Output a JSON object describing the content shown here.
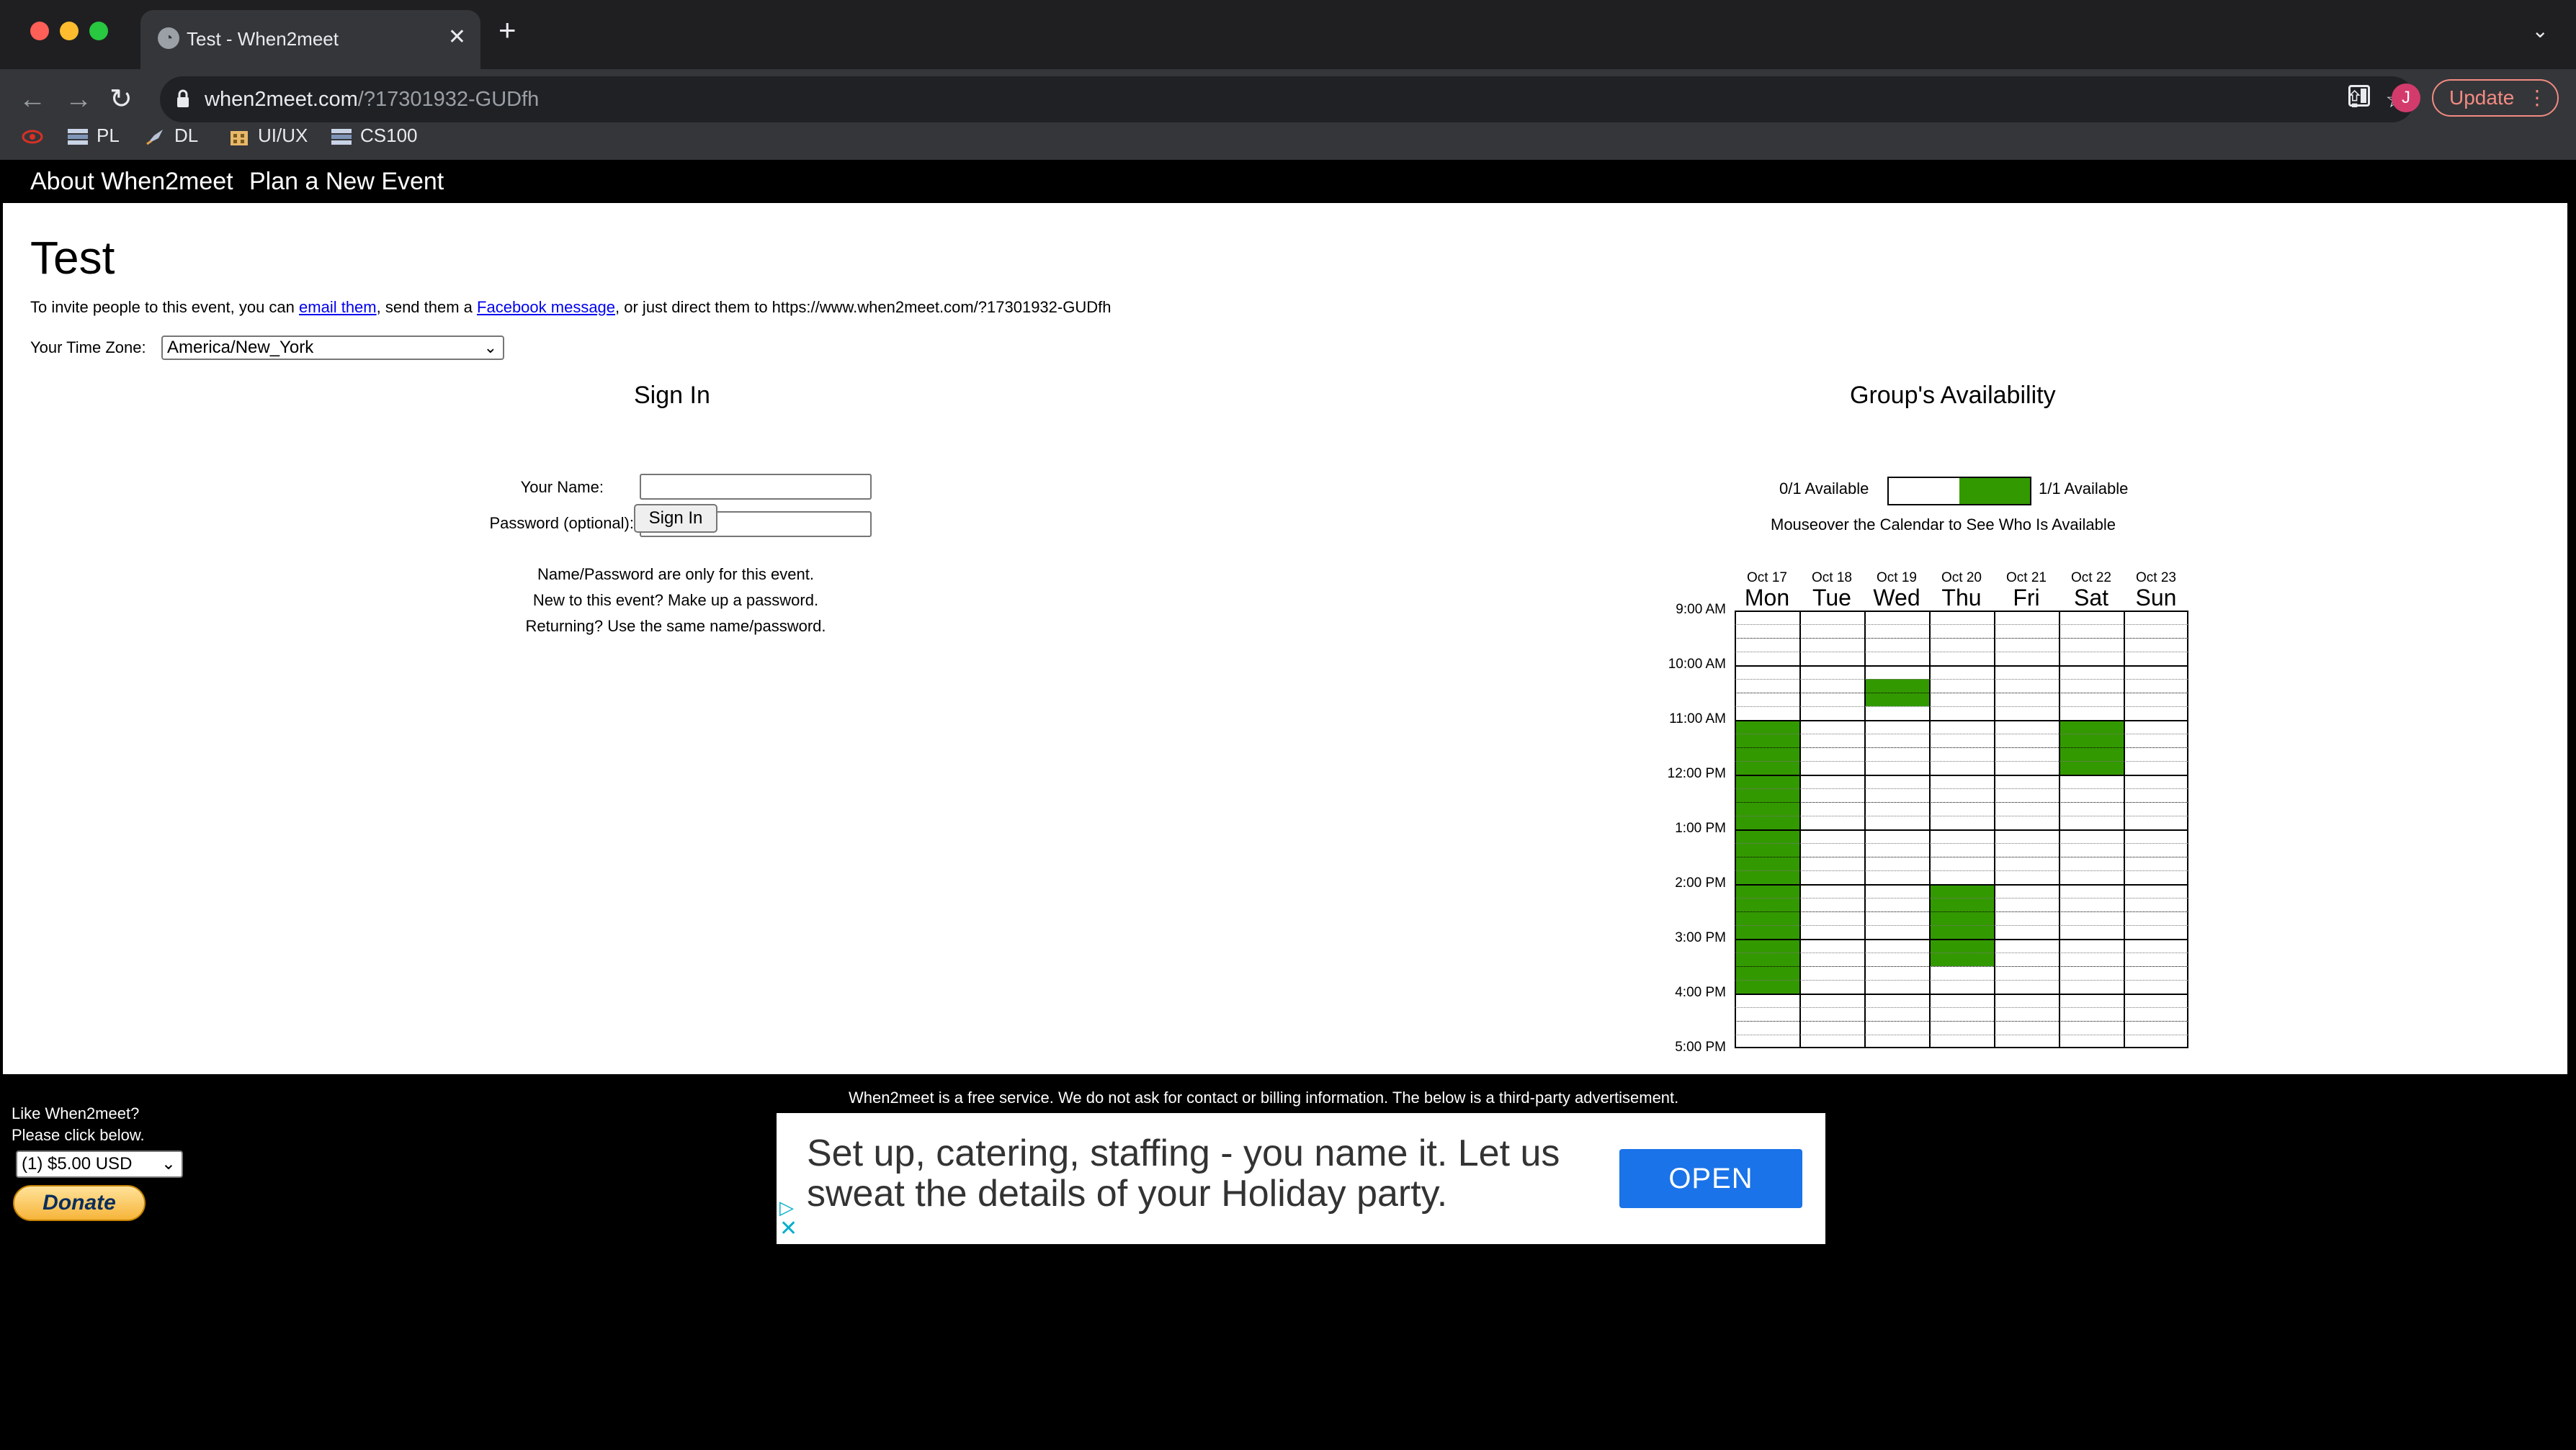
{
  "browser": {
    "tab_title": "Test - When2meet",
    "url_host": "when2meet.com",
    "url_path": "/?17301932-GUDfh",
    "avatar_letter": "J",
    "update_label": "Update",
    "bookmarks": [
      {
        "label": ""
      },
      {
        "label": "PL"
      },
      {
        "label": "DL"
      },
      {
        "label": "UI/UX"
      },
      {
        "label": "CS100"
      }
    ]
  },
  "nav": {
    "about": "About When2meet",
    "plan": "Plan a New Event"
  },
  "event": {
    "title": "Test",
    "invite_prefix": "To invite people to this event, you can ",
    "invite_email": "email them",
    "invite_mid": ", send them a ",
    "invite_fb": "Facebook message",
    "invite_suffix": ", or just direct them to https://www.when2meet.com/?17301932-GUDfh",
    "timezone_label": "Your Time Zone:",
    "timezone_value": "America/New_York"
  },
  "signin": {
    "heading": "Sign In",
    "name_label": "Your Name:",
    "password_label": "Password (optional):",
    "button": "Sign In",
    "note1": "Name/Password are only for this event.",
    "note2": "New to this event? Make up a password.",
    "note3": "Returning? Use the same name/password."
  },
  "availability": {
    "heading": "Group's Availability",
    "legend_min": "0/1 Available",
    "legend_max": "1/1 Available",
    "mouseover": "Mouseover the Calendar to See Who Is Available",
    "available_color": "#339900",
    "days": [
      {
        "date": "Oct 17",
        "name": "Mon"
      },
      {
        "date": "Oct 18",
        "name": "Tue"
      },
      {
        "date": "Oct 19",
        "name": "Wed"
      },
      {
        "date": "Oct 20",
        "name": "Thu"
      },
      {
        "date": "Oct 21",
        "name": "Fri"
      },
      {
        "date": "Oct 22",
        "name": "Sat"
      },
      {
        "date": "Oct 23",
        "name": "Sun"
      }
    ],
    "times": [
      "9:00 AM",
      "10:00 AM",
      "11:00 AM",
      "12:00 PM",
      "1:00 PM",
      "2:00 PM",
      "3:00 PM",
      "4:00 PM",
      "5:00 PM"
    ],
    "available": {
      "Mon": [
        "11:00",
        "11:15",
        "11:30",
        "11:45",
        "12:00",
        "12:15",
        "12:30",
        "12:45",
        "13:00",
        "13:15",
        "13:30",
        "13:45",
        "14:00",
        "14:15",
        "14:30",
        "14:45",
        "15:00",
        "15:15",
        "15:30",
        "15:45"
      ],
      "Wed": [
        "10:15",
        "10:30"
      ],
      "Thu": [
        "14:00",
        "14:15",
        "14:30",
        "14:45",
        "15:00",
        "15:15"
      ],
      "Sat": [
        "11:00",
        "11:15",
        "11:30",
        "11:45"
      ]
    }
  },
  "footer": {
    "note": "When2meet is a free service. We do not ask for contact or billing information. The below is a third-party advertisement.",
    "like1": "Like When2meet?",
    "like2": "Please click below.",
    "donate_amount": "(1) $5.00 USD",
    "donate_button": "Donate",
    "ad_text": "Set up, catering, staffing - you name it. Let us sweat the details of your Holiday party.",
    "ad_button": "OPEN"
  }
}
